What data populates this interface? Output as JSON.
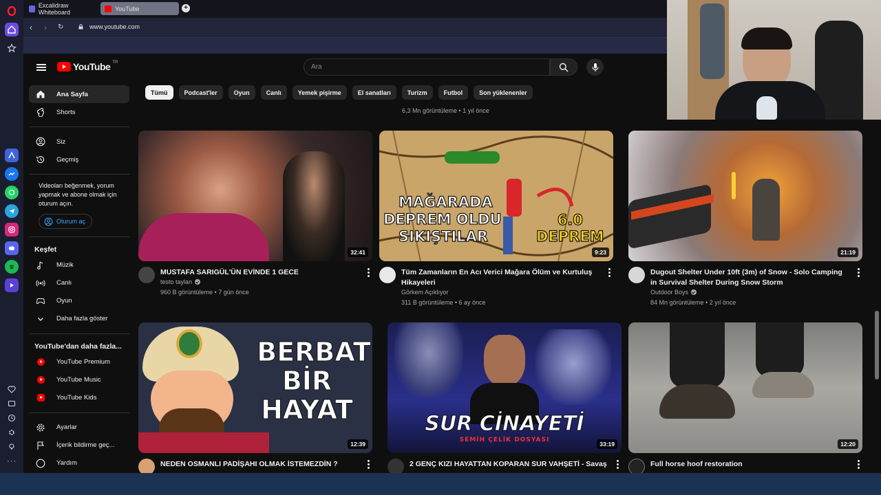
{
  "browser": {
    "tabs": [
      {
        "label": "Excalidraw Whiteboard",
        "active": false
      },
      {
        "label": "YouTube",
        "active": true
      }
    ],
    "url": "www.youtube.com"
  },
  "youtube": {
    "logo_text": "YouTube",
    "logo_country": "TR",
    "search_placeholder": "Ara",
    "sidebar": {
      "main": [
        {
          "label": "Ana Sayfa",
          "icon": "home-icon",
          "active": true
        },
        {
          "label": "Shorts",
          "icon": "shorts-icon"
        }
      ],
      "you": [
        {
          "label": "Siz",
          "icon": "user-icon"
        },
        {
          "label": "Geçmiş",
          "icon": "history-icon"
        }
      ],
      "signin_text": "Videoları beğenmek, yorum yapmak ve abone olmak için oturum açın.",
      "signin_button": "Oturum aç",
      "explore_title": "Keşfet",
      "explore": [
        {
          "label": "Müzik",
          "icon": "music-icon"
        },
        {
          "label": "Canlı",
          "icon": "live-icon"
        },
        {
          "label": "Oyun",
          "icon": "gaming-icon"
        },
        {
          "label": "Daha fazla göster",
          "icon": "chevron-down-icon"
        }
      ],
      "more_title": "YouTube'dan daha fazla...",
      "more": [
        {
          "label": "YouTube Premium"
        },
        {
          "label": "YouTube Music"
        },
        {
          "label": "YouTube Kids"
        }
      ],
      "settings": [
        {
          "label": "Ayarlar",
          "icon": "gear-icon"
        },
        {
          "label": "İçerik bildirme geç...",
          "icon": "flag-icon"
        },
        {
          "label": "Yardım",
          "icon": "help-icon"
        }
      ]
    },
    "chips": [
      "Tümü",
      "Podcast'ler",
      "Oyun",
      "Canlı",
      "Yemek pişirme",
      "El sanatları",
      "Turizm",
      "Futbol",
      "Son yüklenenler"
    ],
    "top_meta": "6,3 Mn görüntüleme • 1 yıl önce",
    "videos": [
      {
        "title": "MUSTAFA SARIGÜL'ÜN EVİNDE 1 GECE",
        "channel": "testo taylan",
        "verified": true,
        "meta": "960 B görüntüleme • 7 gün önce",
        "duration": "32:41"
      },
      {
        "title": "Tüm Zamanların En Acı Verici Mağara Ölüm ve Kurtuluş Hikayeleri",
        "channel": "Görkem Açıklıyor",
        "verified": false,
        "meta": "311 B görüntüleme • 6 ay önce",
        "duration": "9:23",
        "thumb_text": [
          "MAĞARADA",
          "DEPREM OLDU",
          "SIKIŞTILAR",
          "6.0",
          "DEPREM"
        ]
      },
      {
        "title": "Dugout Shelter Under 10ft (3m) of Snow - Solo Camping in Survival Shelter During Snow Storm",
        "channel": "Outdoor Boys",
        "verified": true,
        "meta": "84 Mn görüntüleme • 2 yıl önce",
        "duration": "21:19"
      },
      {
        "title": "NEDEN OSMANLI PADİŞAHI OLMAK İSTEMEZDİN ?",
        "channel": "",
        "verified": false,
        "meta": "",
        "duration": "12:39",
        "thumb_text": [
          "BERBAT",
          "BİR HAYAT"
        ]
      },
      {
        "title": "2 GENÇ KIZI HAYATTAN KOPARAN SUR VAHŞETİ - Savaş",
        "channel": "",
        "verified": false,
        "meta": "",
        "duration": "33:19",
        "thumb_text": [
          "SUR CİNAYETİ",
          "SEMİH ÇELİK DOSYASI"
        ]
      },
      {
        "title": "Full horse hoof restoration",
        "channel": "",
        "verified": false,
        "meta": "",
        "duration": "12:20"
      }
    ]
  },
  "colors": {
    "accent": "#ff0000",
    "link": "#3ea6ff",
    "background": "#0f0f0f"
  }
}
